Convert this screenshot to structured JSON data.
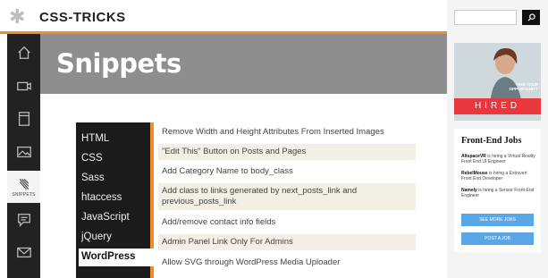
{
  "header": {
    "logo_symbol": "✱",
    "logo_text": "CSS-TRICKS"
  },
  "search": {
    "placeholder": "",
    "button_icon": "search-icon"
  },
  "sidebar": {
    "items": [
      {
        "icon": "home-icon"
      },
      {
        "icon": "video-icon"
      },
      {
        "icon": "book-icon"
      },
      {
        "icon": "image-icon"
      },
      {
        "icon": "snippets-icon",
        "label": "SNIPPETS",
        "active": true
      },
      {
        "icon": "chat-icon"
      },
      {
        "icon": "mail-icon"
      }
    ]
  },
  "hero": {
    "title": "Snippets"
  },
  "categories": [
    {
      "label": "HTML"
    },
    {
      "label": "CSS"
    },
    {
      "label": "Sass"
    },
    {
      "label": "htaccess"
    },
    {
      "label": "JavaScript"
    },
    {
      "label": "jQuery"
    },
    {
      "label": "WordPress",
      "active": true
    }
  ],
  "snippets": [
    {
      "title": "Remove Width and Height Attributes From Inserted Images"
    },
    {
      "title": "\"Edit This\" Button on Posts and Pages"
    },
    {
      "title": "Add Category Name to body_class"
    },
    {
      "title": "Add class to links generated by next_posts_link and previous_posts_link"
    },
    {
      "title": "Add/remove contact info fields"
    },
    {
      "title": "Admin Panel Link Only For Admins"
    },
    {
      "title": "Allow SVG through WordPress Media Uploader"
    }
  ],
  "ad": {
    "tagline_line1": "FIND YOUR",
    "tagline_line2": "OPPORTUNITY",
    "brand": "HIRED"
  },
  "jobs": {
    "title": "Front-End Jobs",
    "listings": [
      {
        "company": "AltspaceVR",
        "text": "is hiring a Virtual Reality Front End UI Engineer"
      },
      {
        "company": "RebelMouse",
        "text": "is hiring a Extrovert Front End Developer"
      },
      {
        "company": "Namely",
        "text": "is hiring a Sensor Front-End Engineer"
      }
    ],
    "more_button": "SEE MORE JOBS",
    "post_button": "POST A JOB"
  },
  "colors": {
    "accent": "#f08d24",
    "hero_bg": "#8e8e8e",
    "sidebar_bg": "#222222",
    "hired_red": "#e8373d",
    "job_button": "#5aa7e8"
  }
}
